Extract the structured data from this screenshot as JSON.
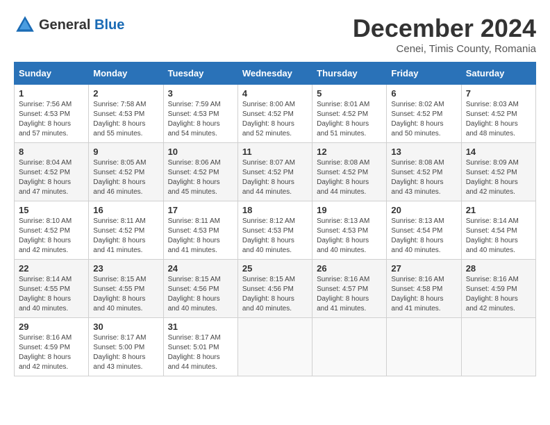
{
  "header": {
    "logo_general": "General",
    "logo_blue": "Blue",
    "month_title": "December 2024",
    "subtitle": "Cenei, Timis County, Romania"
  },
  "calendar": {
    "days_of_week": [
      "Sunday",
      "Monday",
      "Tuesday",
      "Wednesday",
      "Thursday",
      "Friday",
      "Saturday"
    ],
    "weeks": [
      [
        {
          "day": "1",
          "sunrise": "7:56 AM",
          "sunset": "4:53 PM",
          "daylight": "8 hours and 57 minutes."
        },
        {
          "day": "2",
          "sunrise": "7:58 AM",
          "sunset": "4:53 PM",
          "daylight": "8 hours and 55 minutes."
        },
        {
          "day": "3",
          "sunrise": "7:59 AM",
          "sunset": "4:53 PM",
          "daylight": "8 hours and 54 minutes."
        },
        {
          "day": "4",
          "sunrise": "8:00 AM",
          "sunset": "4:52 PM",
          "daylight": "8 hours and 52 minutes."
        },
        {
          "day": "5",
          "sunrise": "8:01 AM",
          "sunset": "4:52 PM",
          "daylight": "8 hours and 51 minutes."
        },
        {
          "day": "6",
          "sunrise": "8:02 AM",
          "sunset": "4:52 PM",
          "daylight": "8 hours and 50 minutes."
        },
        {
          "day": "7",
          "sunrise": "8:03 AM",
          "sunset": "4:52 PM",
          "daylight": "8 hours and 48 minutes."
        }
      ],
      [
        {
          "day": "8",
          "sunrise": "8:04 AM",
          "sunset": "4:52 PM",
          "daylight": "8 hours and 47 minutes."
        },
        {
          "day": "9",
          "sunrise": "8:05 AM",
          "sunset": "4:52 PM",
          "daylight": "8 hours and 46 minutes."
        },
        {
          "day": "10",
          "sunrise": "8:06 AM",
          "sunset": "4:52 PM",
          "daylight": "8 hours and 45 minutes."
        },
        {
          "day": "11",
          "sunrise": "8:07 AM",
          "sunset": "4:52 PM",
          "daylight": "8 hours and 44 minutes."
        },
        {
          "day": "12",
          "sunrise": "8:08 AM",
          "sunset": "4:52 PM",
          "daylight": "8 hours and 44 minutes."
        },
        {
          "day": "13",
          "sunrise": "8:08 AM",
          "sunset": "4:52 PM",
          "daylight": "8 hours and 43 minutes."
        },
        {
          "day": "14",
          "sunrise": "8:09 AM",
          "sunset": "4:52 PM",
          "daylight": "8 hours and 42 minutes."
        }
      ],
      [
        {
          "day": "15",
          "sunrise": "8:10 AM",
          "sunset": "4:52 PM",
          "daylight": "8 hours and 42 minutes."
        },
        {
          "day": "16",
          "sunrise": "8:11 AM",
          "sunset": "4:52 PM",
          "daylight": "8 hours and 41 minutes."
        },
        {
          "day": "17",
          "sunrise": "8:11 AM",
          "sunset": "4:53 PM",
          "daylight": "8 hours and 41 minutes."
        },
        {
          "day": "18",
          "sunrise": "8:12 AM",
          "sunset": "4:53 PM",
          "daylight": "8 hours and 40 minutes."
        },
        {
          "day": "19",
          "sunrise": "8:13 AM",
          "sunset": "4:53 PM",
          "daylight": "8 hours and 40 minutes."
        },
        {
          "day": "20",
          "sunrise": "8:13 AM",
          "sunset": "4:54 PM",
          "daylight": "8 hours and 40 minutes."
        },
        {
          "day": "21",
          "sunrise": "8:14 AM",
          "sunset": "4:54 PM",
          "daylight": "8 hours and 40 minutes."
        }
      ],
      [
        {
          "day": "22",
          "sunrise": "8:14 AM",
          "sunset": "4:55 PM",
          "daylight": "8 hours and 40 minutes."
        },
        {
          "day": "23",
          "sunrise": "8:15 AM",
          "sunset": "4:55 PM",
          "daylight": "8 hours and 40 minutes."
        },
        {
          "day": "24",
          "sunrise": "8:15 AM",
          "sunset": "4:56 PM",
          "daylight": "8 hours and 40 minutes."
        },
        {
          "day": "25",
          "sunrise": "8:15 AM",
          "sunset": "4:56 PM",
          "daylight": "8 hours and 40 minutes."
        },
        {
          "day": "26",
          "sunrise": "8:16 AM",
          "sunset": "4:57 PM",
          "daylight": "8 hours and 41 minutes."
        },
        {
          "day": "27",
          "sunrise": "8:16 AM",
          "sunset": "4:58 PM",
          "daylight": "8 hours and 41 minutes."
        },
        {
          "day": "28",
          "sunrise": "8:16 AM",
          "sunset": "4:59 PM",
          "daylight": "8 hours and 42 minutes."
        }
      ],
      [
        {
          "day": "29",
          "sunrise": "8:16 AM",
          "sunset": "4:59 PM",
          "daylight": "8 hours and 42 minutes."
        },
        {
          "day": "30",
          "sunrise": "8:17 AM",
          "sunset": "5:00 PM",
          "daylight": "8 hours and 43 minutes."
        },
        {
          "day": "31",
          "sunrise": "8:17 AM",
          "sunset": "5:01 PM",
          "daylight": "8 hours and 44 minutes."
        },
        null,
        null,
        null,
        null
      ]
    ]
  }
}
